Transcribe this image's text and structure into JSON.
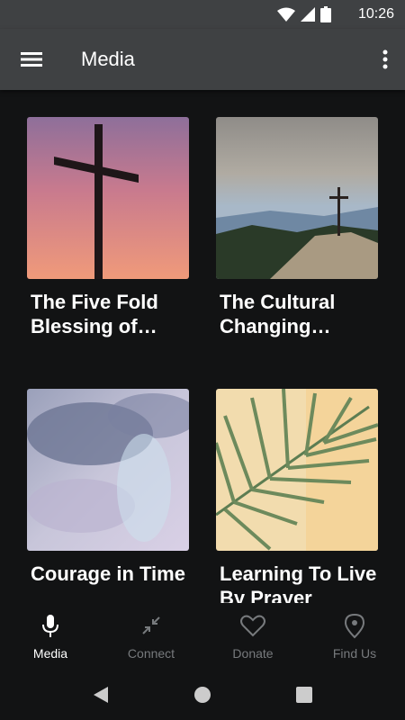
{
  "status": {
    "time": "10:26"
  },
  "appbar": {
    "title": "Media"
  },
  "cards": [
    {
      "title": "The Five Fold Blessing of Ret..."
    },
    {
      "title": "The Cultural Changing Impa..."
    },
    {
      "title": "Courage in Time"
    },
    {
      "title": "Learning To Live By Prayer"
    }
  ],
  "nav": {
    "items": [
      {
        "label": "Media",
        "icon": "microphone-icon",
        "active": true
      },
      {
        "label": "Connect",
        "icon": "collapse-arrows-icon"
      },
      {
        "label": "Donate",
        "icon": "heart-icon"
      },
      {
        "label": "Find Us",
        "icon": "location-pin-icon"
      }
    ]
  },
  "colors": {
    "bar": "#3f4143",
    "background": "#121314",
    "inactive": "#777a7d"
  }
}
